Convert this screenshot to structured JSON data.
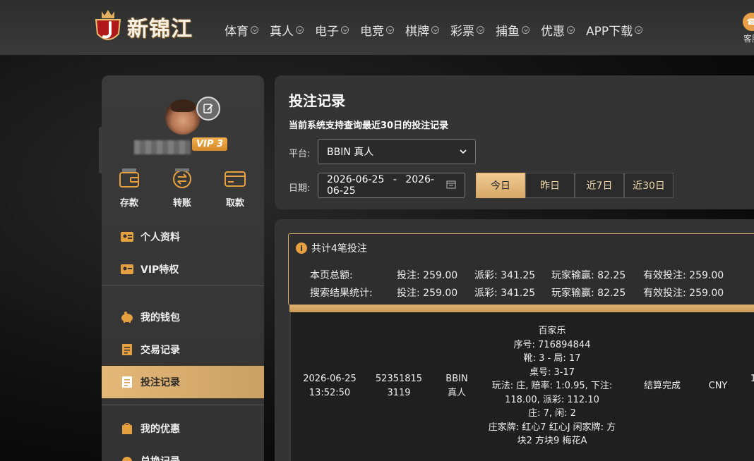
{
  "header": {
    "logo_text": "新锦江",
    "nav": [
      "体育",
      "真人",
      "电子",
      "电竞",
      "棋牌",
      "彩票",
      "捕鱼",
      "优惠",
      "APP下载"
    ],
    "service_label": "客服"
  },
  "sidebar": {
    "vip_badge": "VIP 3",
    "quick_actions": [
      {
        "label": "存款",
        "icon": "wallet-icon"
      },
      {
        "label": "转账",
        "icon": "transfer-icon"
      },
      {
        "label": "取款",
        "icon": "card-icon"
      }
    ],
    "menu_group1": [
      {
        "label": "个人资料",
        "icon": "id-card-icon"
      },
      {
        "label": "VIP特权",
        "icon": "vip-card-icon"
      }
    ],
    "menu_group2": [
      {
        "label": "我的钱包",
        "icon": "piggy-bank-icon"
      },
      {
        "label": "交易记录",
        "icon": "document-icon"
      },
      {
        "label": "投注记录",
        "icon": "bet-record-icon",
        "active": true
      }
    ],
    "menu_group3": [
      {
        "label": "我的优惠",
        "icon": "gift-icon"
      },
      {
        "label": "兑换记录",
        "icon": "exchange-icon"
      }
    ]
  },
  "query": {
    "title": "投注记录",
    "subtitle": "当前系统支持查询最近30日的投注记录",
    "platform_label": "平台:",
    "platform_value": "BBIN 真人",
    "date_label": "日期:",
    "date_start": "2026-06-25",
    "date_sep": "-",
    "date_end": "2026-06-25",
    "ranges": [
      "今日",
      "昨日",
      "近7日",
      "近30日"
    ],
    "active_range": "今日"
  },
  "results": {
    "count_text": "共计4笔投注",
    "page_total": {
      "label": "本页总额:",
      "bet": "投注: 259.00",
      "payout": "派彩: 341.25",
      "win": "玩家输赢: 82.25",
      "valid": "有效投注: 259.00"
    },
    "search_total": {
      "label": "搜索结果统计:",
      "bet": "投注: 259.00",
      "payout": "派彩: 341.25",
      "win": "玩家输赢: 82.25",
      "valid": "有效投注: 259.00"
    },
    "rows": [
      {
        "time_date": "2026-06-25",
        "time_clock": "13:52:50",
        "order_no_1": "52351815",
        "order_no_2": "3119",
        "platform_1": "BBIN",
        "platform_2": "真人",
        "detail": [
          "百家乐",
          "序号: 716894844",
          "靴: 3 - 局: 17",
          "桌号: 3-17",
          "玩法: 庄, 赔率: 1:0.95, 下注:",
          "118.00, 派彩: 112.10",
          "庄: 7, 闲: 2",
          "庄家牌: 红心7 红心J 闲家牌: 方",
          "块2 方块9 梅花A"
        ],
        "status": "结算完成",
        "currency": "CNY",
        "amount_partial": "1"
      }
    ]
  }
}
